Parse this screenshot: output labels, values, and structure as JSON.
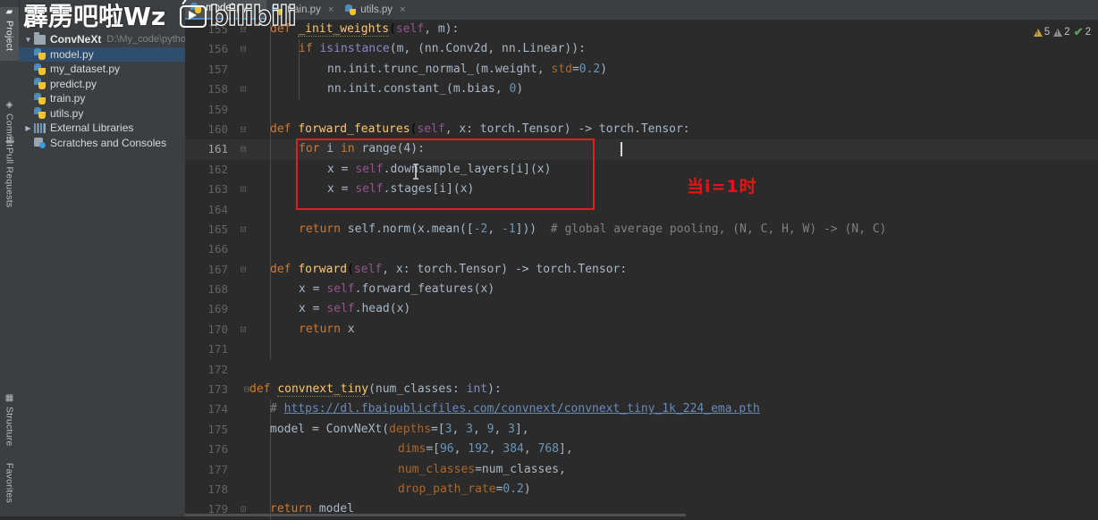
{
  "window": {
    "watermark_cn": "霹雳吧啦Wz",
    "watermark_brand": "bilibili"
  },
  "left_toolbar": {
    "tabs": [
      {
        "label": "Project",
        "icon": "folder-icon",
        "selected": true
      },
      {
        "label": "Commit",
        "icon": "commit-icon",
        "selected": false
      },
      {
        "label": "Pull Requests",
        "icon": "pull-request-icon",
        "selected": false
      },
      {
        "label": "Structure",
        "icon": "structure-icon",
        "selected": false
      },
      {
        "label": "Favorites",
        "icon": "star-icon",
        "selected": false
      }
    ]
  },
  "sidebar": {
    "root": {
      "label": "ConvNeXt",
      "path": "D:\\My_code\\pythonP",
      "expanded": true
    },
    "items": [
      {
        "label": "model.py",
        "icon": "python-file-icon",
        "selected": true
      },
      {
        "label": "my_dataset.py",
        "icon": "python-file-icon",
        "selected": false
      },
      {
        "label": "predict.py",
        "icon": "python-file-icon",
        "selected": false
      },
      {
        "label": "train.py",
        "icon": "python-file-icon",
        "selected": false
      },
      {
        "label": "utils.py",
        "icon": "python-file-icon",
        "selected": false
      }
    ],
    "external_libraries": "External Libraries",
    "scratches": "Scratches and Consoles"
  },
  "tabs": [
    {
      "label": "model.py",
      "active": true,
      "close": "×"
    },
    {
      "label": "train.py",
      "active": false,
      "close": "×"
    },
    {
      "label": "utils.py",
      "active": false,
      "close": "×"
    }
  ],
  "inspections": {
    "warnings": "5",
    "weak_warnings": "2",
    "checks": "2",
    "warning_color": "#c8a03c",
    "check_color": "#5a9e5a"
  },
  "annotation": {
    "note_text": "当i=1时",
    "note_color": "#e81313",
    "box_color": "#e02020",
    "box_lines": [
      161,
      162,
      163
    ]
  },
  "editor": {
    "current_line": 161,
    "first_line": 155,
    "last_line": 179,
    "lines": [
      {
        "n": "155",
        "fold": "minus-down",
        "indent": 1
      },
      {
        "n": "156",
        "fold": "minus-down",
        "indent": 2
      },
      {
        "n": "157",
        "fold": "",
        "indent": 2
      },
      {
        "n": "158",
        "fold": "minus-up",
        "indent": 2
      },
      {
        "n": "159",
        "fold": "",
        "indent": 1
      },
      {
        "n": "160",
        "fold": "minus-down",
        "indent": 1
      },
      {
        "n": "161",
        "fold": "minus-down",
        "indent": 2
      },
      {
        "n": "162",
        "fold": "",
        "indent": 2
      },
      {
        "n": "163",
        "fold": "minus-up",
        "indent": 2
      },
      {
        "n": "164",
        "fold": "",
        "indent": 2
      },
      {
        "n": "165",
        "fold": "minus-up",
        "indent": 2
      },
      {
        "n": "166",
        "fold": "",
        "indent": 1
      },
      {
        "n": "167",
        "fold": "minus-down",
        "indent": 1
      },
      {
        "n": "168",
        "fold": "",
        "indent": 2
      },
      {
        "n": "169",
        "fold": "",
        "indent": 2
      },
      {
        "n": "170",
        "fold": "minus-up",
        "indent": 2
      },
      {
        "n": "171",
        "fold": "",
        "indent": 1
      },
      {
        "n": "172",
        "fold": "",
        "indent": 0
      },
      {
        "n": "173",
        "fold": "minus-down",
        "indent": 0
      },
      {
        "n": "174",
        "fold": "",
        "indent": 1
      },
      {
        "n": "175",
        "fold": "",
        "indent": 1
      },
      {
        "n": "176",
        "fold": "",
        "indent": 1
      },
      {
        "n": "177",
        "fold": "",
        "indent": 1
      },
      {
        "n": "178",
        "fold": "",
        "indent": 1
      },
      {
        "n": "179",
        "fold": "minus-up",
        "indent": 1
      }
    ],
    "source": {
      "l155": "    def _init_weights(self, m):",
      "l156": "        if isinstance(m, (nn.Conv2d, nn.Linear)):",
      "l157": "            nn.init.trunc_normal_(m.weight, std=0.2)",
      "l158": "            nn.init.constant_(m.bias, 0)",
      "l159": "",
      "l160": "    def forward_features(self, x: torch.Tensor) -> torch.Tensor:",
      "l161": "        for i in range(4):",
      "l162": "            x = self.downsample_layers[i](x)",
      "l163": "            x = self.stages[i](x)",
      "l164": "",
      "l165": "        return self.norm(x.mean([-2, -1]))  # global average pooling, (N, C, H, W) -> (N, C)",
      "l166": "",
      "l167": "    def forward(self, x: torch.Tensor) -> torch.Tensor:",
      "l168": "        x = self.forward_features(x)",
      "l169": "        x = self.head(x)",
      "l170": "        return x",
      "l171": "",
      "l172": "",
      "l173": "def convnext_tiny(num_classes: int):",
      "l174": "    # https://dl.fbaipublicfiles.com/convnext/convnext_tiny_1k_224_ema.pth",
      "l175": "    model = ConvNeXt(depths=[3, 3, 9, 3],",
      "l176": "                     dims=[96, 192, 384, 768],",
      "l177": "                     num_classes=num_classes,",
      "l178": "                     drop_path_rate=0.2)",
      "l179": "    return model"
    },
    "tokens": {
      "def": "def",
      "init_weights": "_init_weights",
      "self": "self",
      "m": ", m):",
      "if": "if",
      "isinstance": "isinstance",
      "isinstance_args": "(m, (nn.Conv2d, nn.Linear)):",
      "nn_trunc": "nn.init.trunc_normal_(m.weight, ",
      "std": "std",
      "eq": "=",
      "v02": "0.2",
      "rp": ")",
      "nn_const": "nn.init.constant_(m.bias, ",
      "zero": "0",
      "forward_features": "forward_features",
      "ff_sig_a": ", x: torch.Tensor) -> torch.Tensor:",
      "for": "for",
      "i": " i ",
      "in": "in",
      "range4": " range(4):",
      "x_eq": "x = ",
      "dot_down": ".downsample_layers[i](x)",
      "dot_stages": ".stages[i](x)",
      "return": "return",
      "norm_expr": " self.norm(x.mean([",
      "m2": "-2",
      "comma": ", ",
      "m1": "-1",
      "close2": "]))  ",
      "comment_gap": "# global average pooling, (N, C, H, W) -> (N, C)",
      "forward": "forward",
      "fw_sig": ", x: torch.Tensor) -> torch.Tensor:",
      "dot_ff": ".forward_features(x)",
      "dot_head": ".head(x)",
      "ret_x": " x",
      "convnext_tiny": "convnext_tiny",
      "ct_args_a": "(num_classes: ",
      "int": "int",
      "ct_args_b": "):",
      "hash": "# ",
      "link": "https://dl.fbaipublicfiles.com/convnext/convnext_tiny_1k_224_ema.pth",
      "model_eq": "model = ConvNeXt(",
      "depths": "depths",
      "d_list_a": "[",
      "d3a": "3",
      "d3b": "3",
      "d9": "9",
      "d3c": "3",
      "d_list_b": "],",
      "dims": "dims",
      "v96": "96",
      "v192": "192",
      "v384": "384",
      "v768": "768",
      "num_classes_kw": "num_classes",
      "num_classes_val": "num_classes",
      "trail_comma": ",",
      "drop_path_rate": "drop_path_rate",
      "v02b": "0.2",
      "ret_model": " model"
    }
  }
}
